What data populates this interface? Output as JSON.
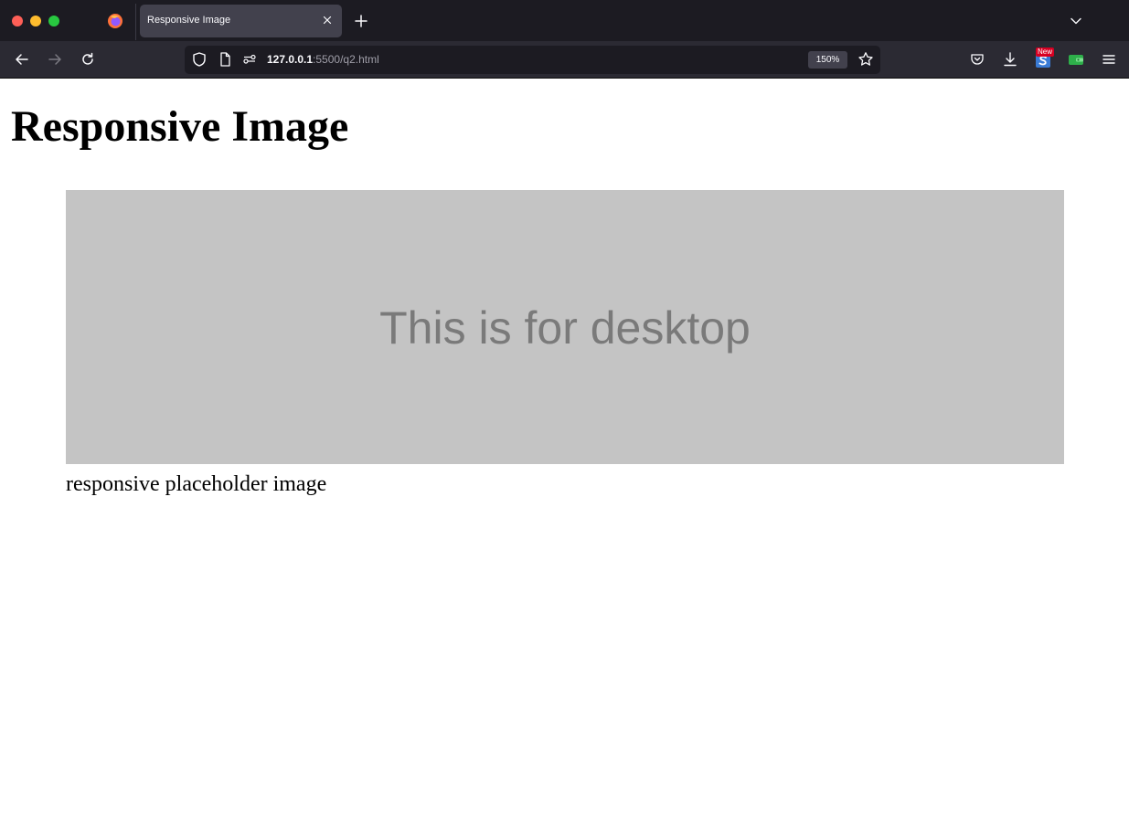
{
  "browser": {
    "tab": {
      "title": "Responsive Image"
    },
    "url": {
      "host": "127.0.0.1",
      "rest": ":5500/q2.html"
    },
    "zoom": "150%",
    "extension_badge": "New"
  },
  "page": {
    "title": "Responsive Image",
    "image_text": "This is for desktop",
    "caption": "responsive placeholder image"
  },
  "colors": {
    "toolbar": "#2b2a33",
    "tabstrip": "#1c1b22",
    "placeholder_bg": "#c4c4c4",
    "placeholder_text": "#7a7a7a"
  }
}
